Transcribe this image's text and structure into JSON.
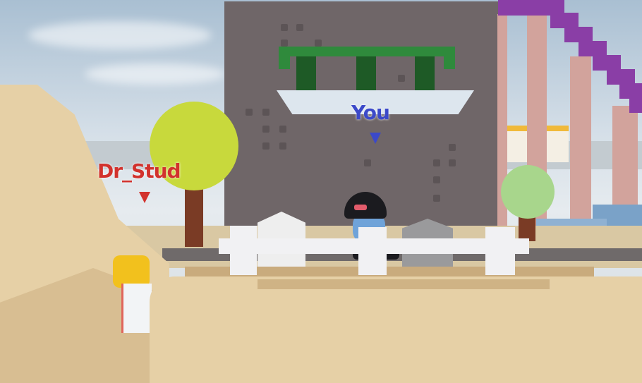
{
  "players": {
    "self": {
      "name": "You",
      "color": "#3b49c9"
    },
    "other": {
      "name": "Dr_Stud",
      "color": "#d2322d"
    }
  },
  "icons": {
    "self_marker": "triangle-down-icon",
    "other_marker": "triangle-down-icon"
  },
  "colors": {
    "sand": "#e6d0a6",
    "wall": "#6f6668",
    "stair": "#8a3ea6",
    "leaf_yellow": "#c8d93c",
    "leaf_green": "#a8d68c"
  }
}
